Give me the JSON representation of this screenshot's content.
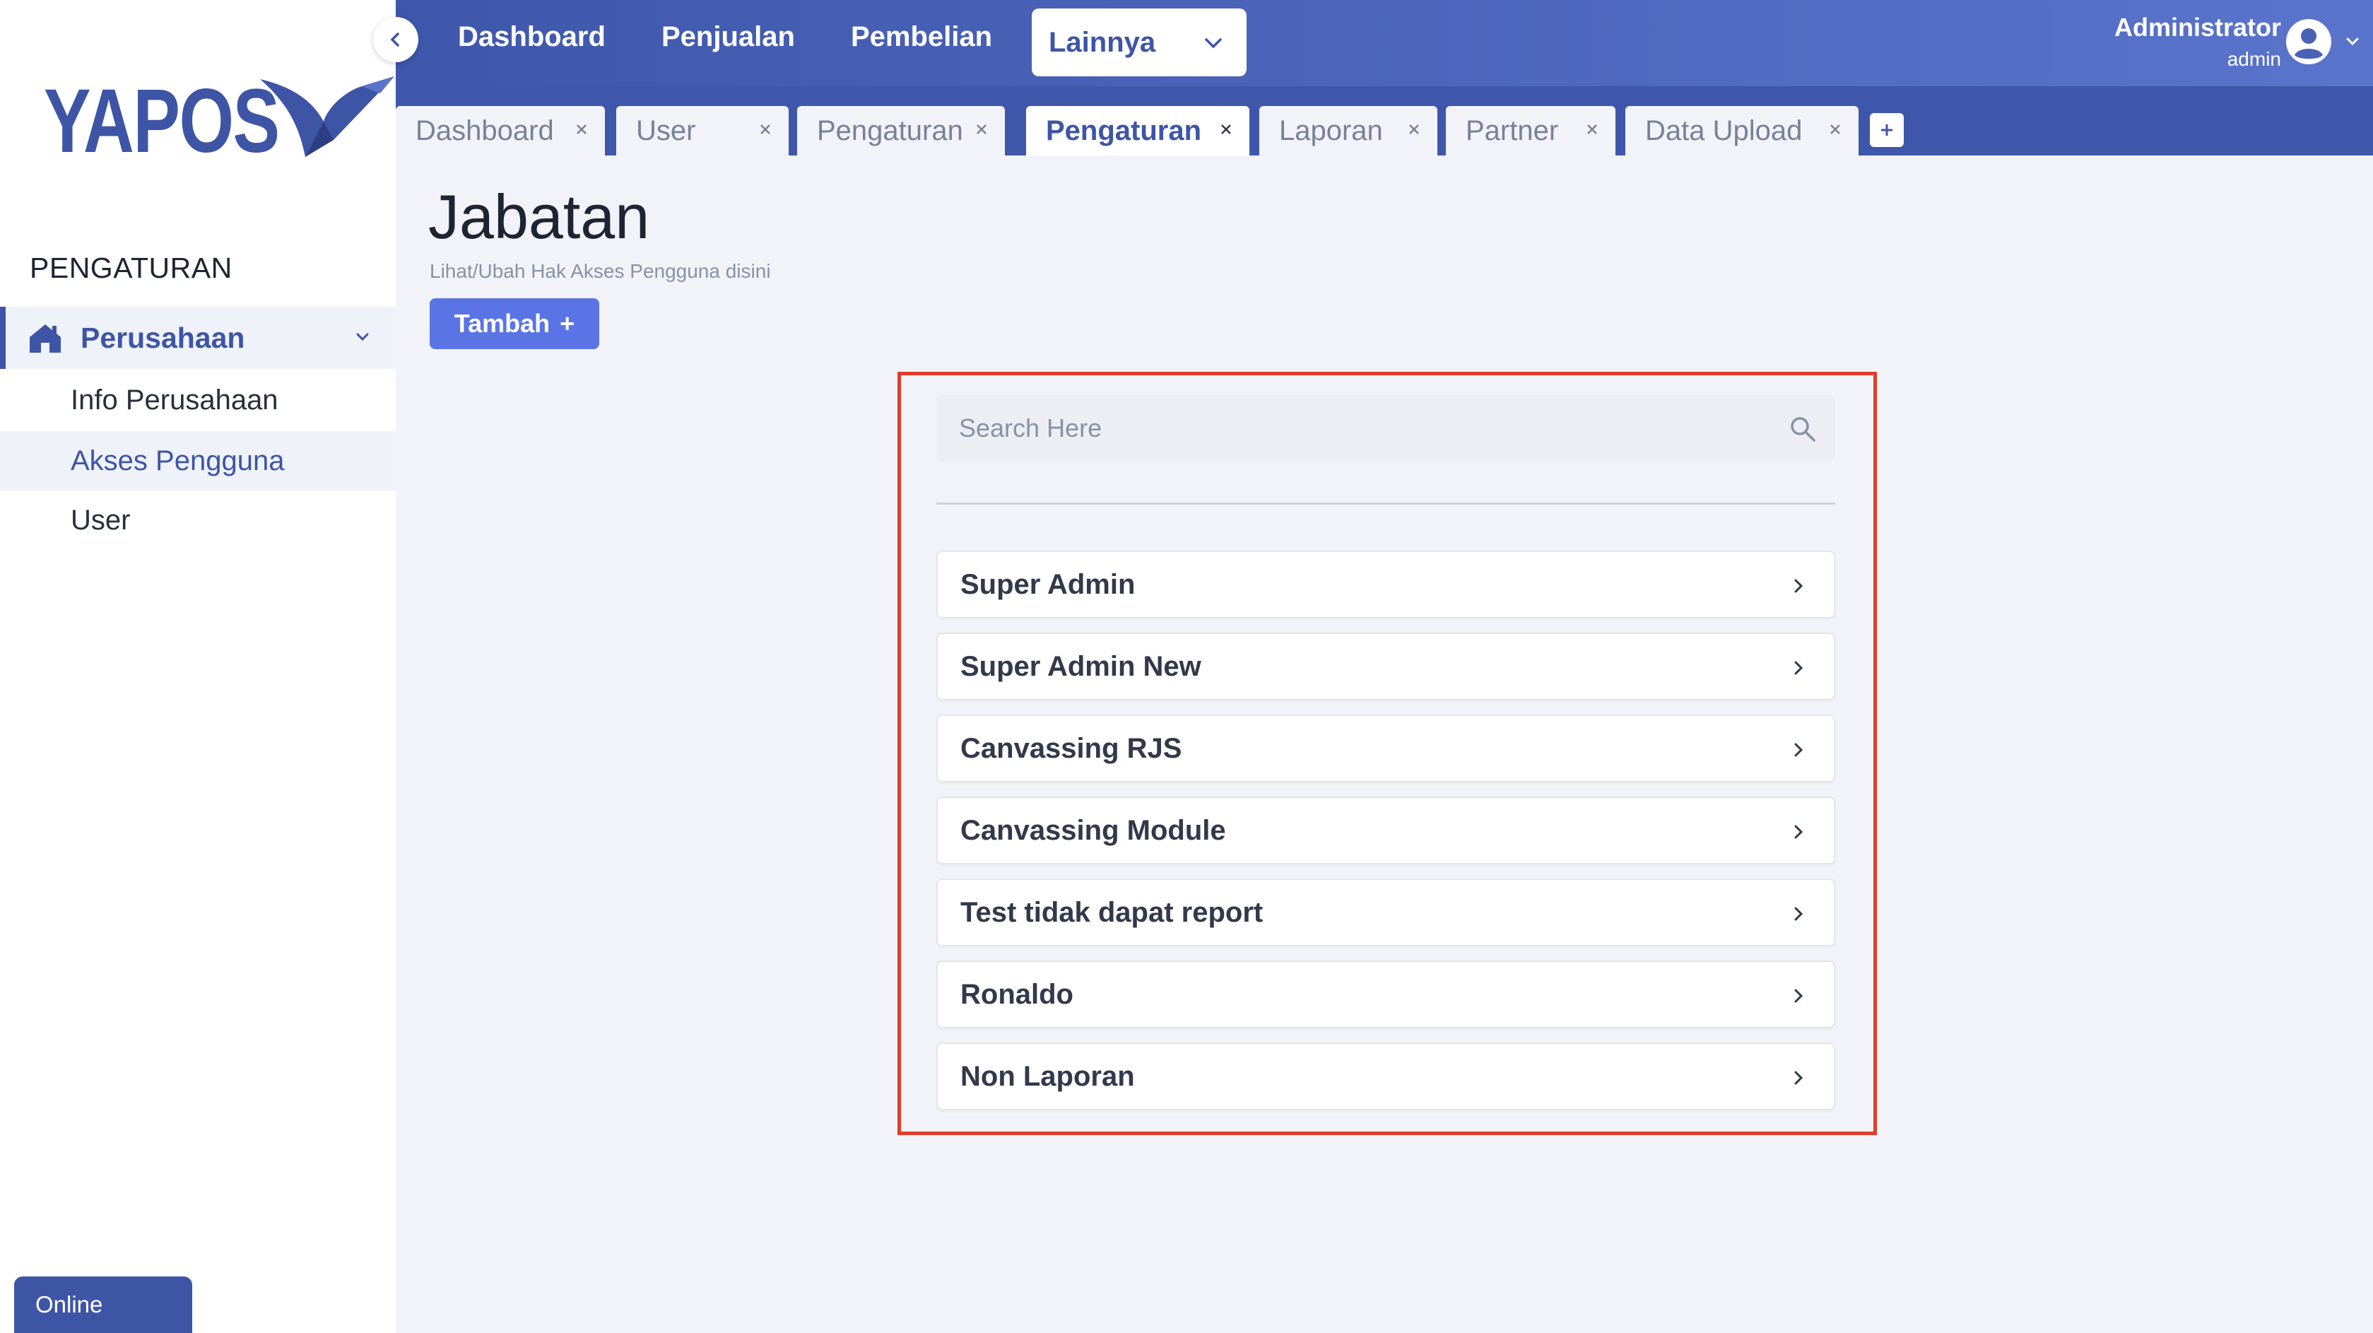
{
  "brand": {
    "name": "YAPOS"
  },
  "sidebar": {
    "section_title": "PENGATURAN",
    "group": {
      "label": "Perusahaan",
      "icon": "home-icon"
    },
    "items": [
      {
        "label": "Info Perusahaan",
        "active": false
      },
      {
        "label": "Akses Pengguna",
        "active": true
      },
      {
        "label": "User",
        "active": false
      }
    ],
    "status": "Online"
  },
  "topnav": {
    "items": [
      "Dashboard",
      "Penjualan",
      "Pembelian"
    ],
    "dropdown": {
      "label": "Lainnya"
    },
    "user": {
      "name": "Administrator",
      "role": "admin"
    }
  },
  "tabs": [
    {
      "label": "Dashboard",
      "active": false
    },
    {
      "label": "User",
      "active": false
    },
    {
      "label": "Pengaturan",
      "active": false
    },
    {
      "label": "Pengaturan",
      "active": true
    },
    {
      "label": "Laporan",
      "active": false
    },
    {
      "label": "Partner",
      "active": false
    },
    {
      "label": "Data Upload",
      "active": false
    }
  ],
  "page": {
    "title": "Jabatan",
    "subtitle": "Lihat/Ubah Hak Akses Pengguna disini",
    "add_button": "Tambah",
    "add_icon": "+"
  },
  "search": {
    "placeholder": "Search Here",
    "value": ""
  },
  "roles": [
    "Super Admin",
    "Super Admin New",
    "Canvassing RJS",
    "Canvassing Module",
    "Test tidak dapat report",
    "Ronaldo",
    "Non Laporan"
  ],
  "colors": {
    "brand": "#3e55a6",
    "topbar_start": "#3f57ab",
    "topbar_end": "#5a74cc",
    "button": "#5a74e6",
    "highlight_border": "#e03c2c"
  }
}
